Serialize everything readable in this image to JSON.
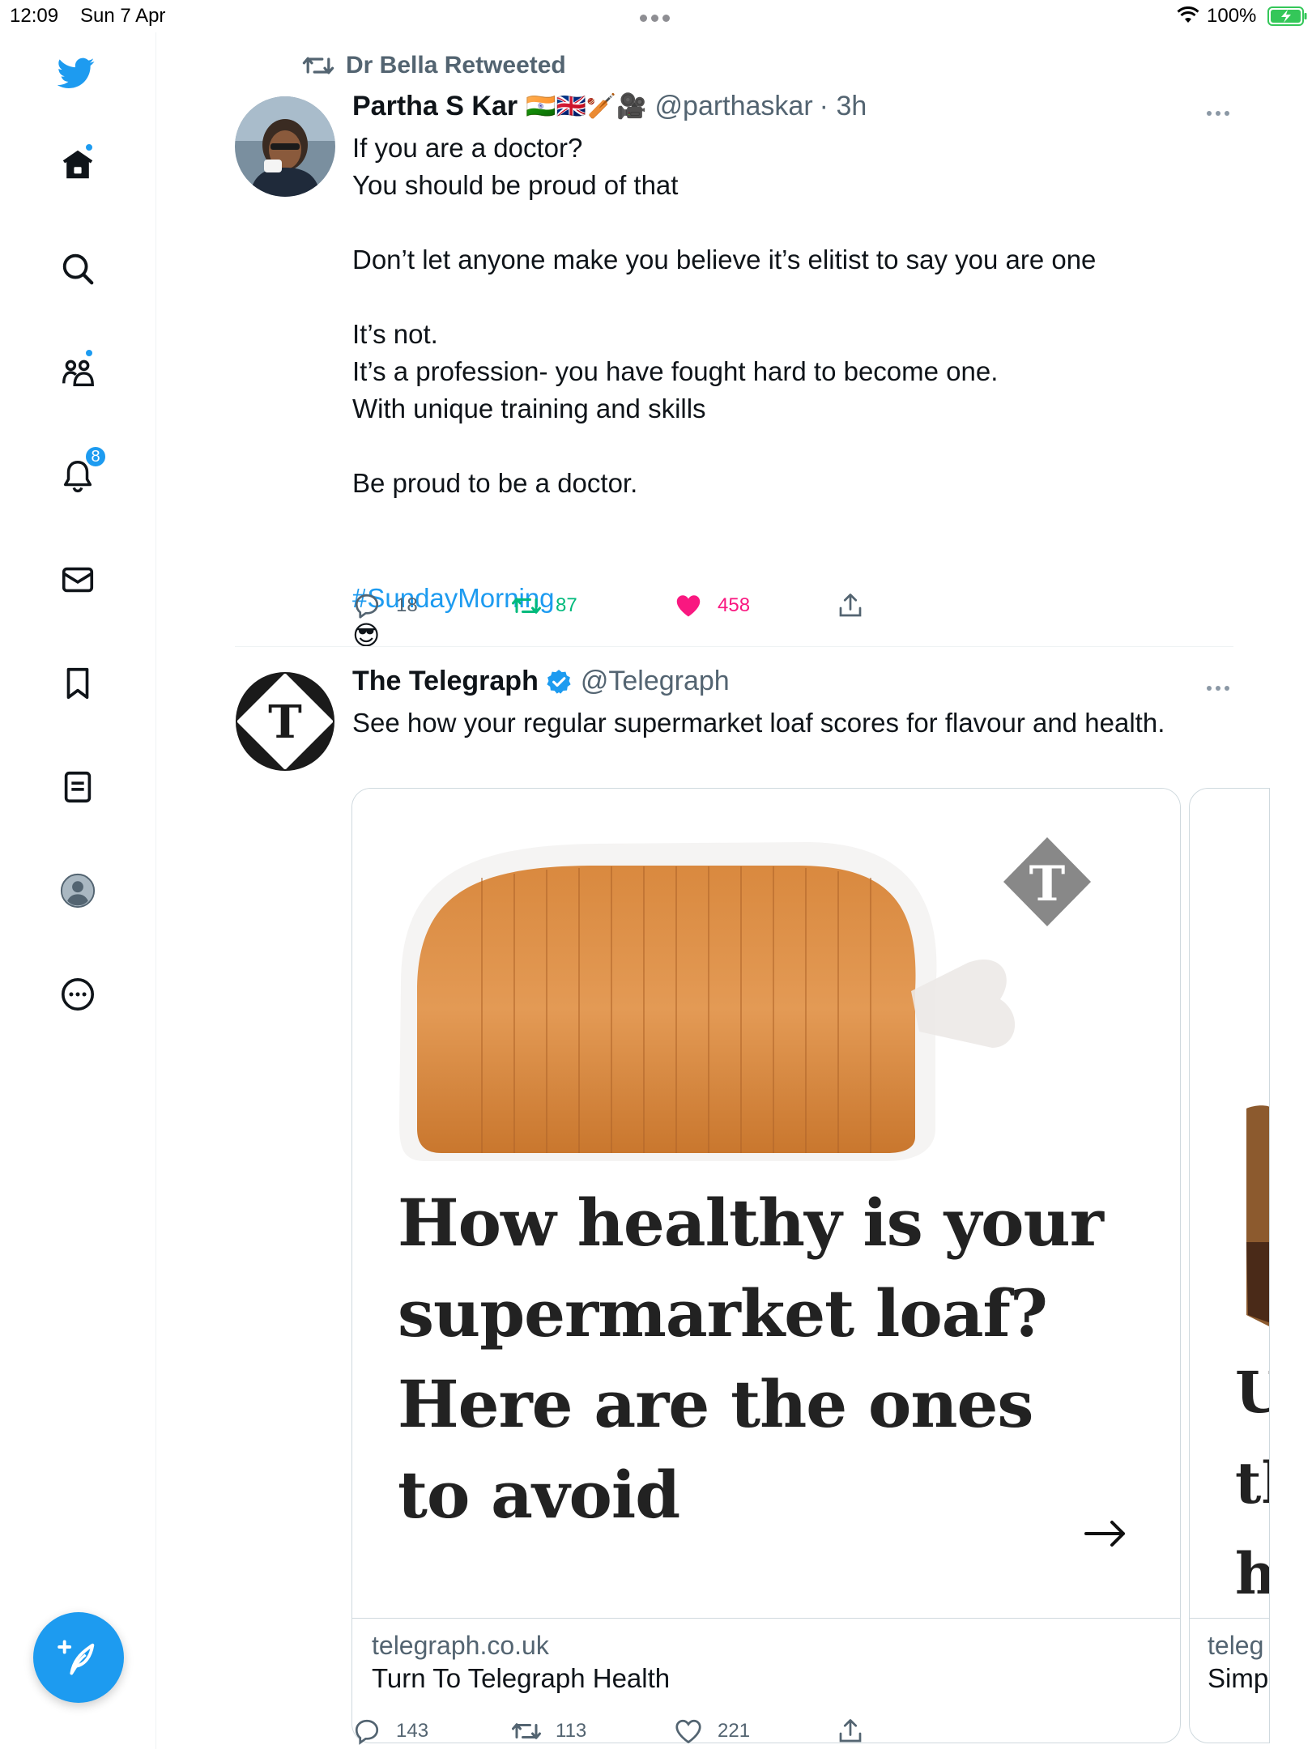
{
  "status_bar": {
    "time": "12:09",
    "date": "Sun 7 Apr",
    "battery": "100%"
  },
  "sidebar": {
    "items": [
      {
        "name": "twitter-logo"
      },
      {
        "name": "home",
        "badge_dot": true
      },
      {
        "name": "search"
      },
      {
        "name": "communities",
        "badge_dot": true
      },
      {
        "name": "notifications",
        "badge_count": "8"
      },
      {
        "name": "messages"
      },
      {
        "name": "bookmarks"
      },
      {
        "name": "lists"
      },
      {
        "name": "profile"
      },
      {
        "name": "more"
      }
    ],
    "accent": "#1d9bf0"
  },
  "tweet1": {
    "retweeted_by": "Dr Bella Retweeted",
    "author": "Partha S Kar",
    "author_emojis": "🇮🇳🇬🇧🏏🎥",
    "handle": "@parthaskar",
    "time": "· 3h",
    "text": "If you are a doctor?\nYou should be proud of that\n\nDon’t let anyone make you believe it’s elitist to say you are one\n\nIt’s not.\nIt’s a profession- you have fought hard to become one.\nWith unique training and skills\n\nBe proud to be a doctor.",
    "hashtag": "#SundayMorning",
    "hashtag_emoji": "😎",
    "replies": "18",
    "retweets": "87",
    "likes": "458",
    "retweet_color": "#00ba7c",
    "like_color": "#f91880"
  },
  "tweet2": {
    "author": "The Telegraph",
    "verified": true,
    "handle": "@Telegraph",
    "text": "See how your regular supermarket loaf scores for flavour and health.",
    "card": {
      "headline": "How healthy is your supermarket loaf? Here are the ones to avoid",
      "domain": "telegraph.co.uk",
      "title": "Turn To Telegraph Health"
    },
    "card2": {
      "headline": "U\ntl\nh",
      "domain": "teleg",
      "title": "Simp"
    },
    "replies": "143",
    "retweets": "113",
    "likes": "221"
  }
}
